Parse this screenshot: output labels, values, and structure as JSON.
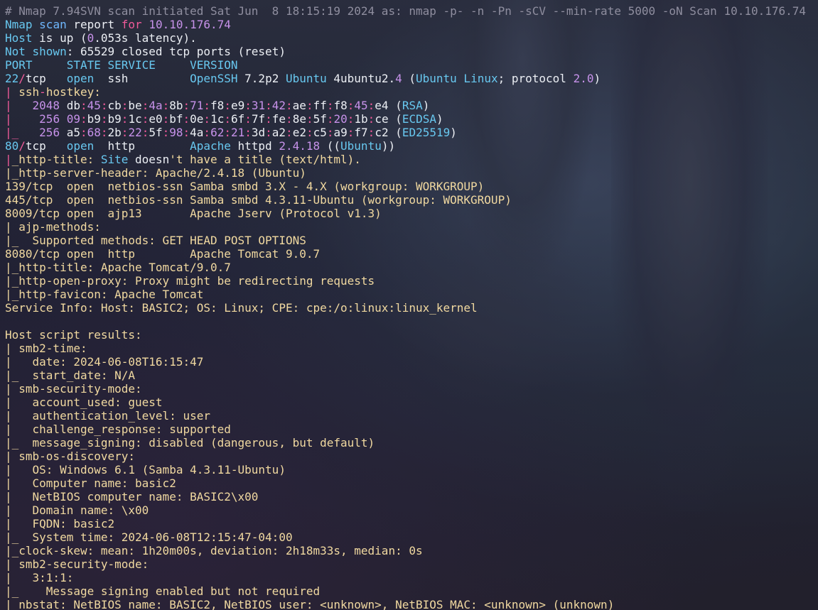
{
  "terminal": {
    "lines": [
      {
        "segments": [
          {
            "t": "# Nmap 7.94SVN scan initiated Sat Jun  8 18:15:19 2024 as: nmap -p- -n -Pn -sCV --min-rate 5000 -oN Scan 10.10.176.74",
            "c": "comment"
          }
        ]
      },
      {
        "segments": [
          {
            "t": "Nmap",
            "c": "cyan"
          },
          {
            "t": " ",
            "c": "white"
          },
          {
            "t": "scan",
            "c": "blue"
          },
          {
            "t": " report ",
            "c": "white"
          },
          {
            "t": "for",
            "c": "pink"
          },
          {
            "t": " ",
            "c": "white"
          },
          {
            "t": "10.10.176.74",
            "c": "purple"
          }
        ]
      },
      {
        "segments": [
          {
            "t": "Host",
            "c": "cyan"
          },
          {
            "t": " is up (",
            "c": "white"
          },
          {
            "t": "0",
            "c": "purple"
          },
          {
            "t": ".053s latency).",
            "c": "white"
          }
        ]
      },
      {
        "segments": [
          {
            "t": "Not shown",
            "c": "cyan"
          },
          {
            "t": ": 65529 closed tcp ports (reset)",
            "c": "white"
          }
        ]
      },
      {
        "segments": [
          {
            "t": "PORT     STATE SERVICE     VERSION",
            "c": "cyan"
          }
        ]
      },
      {
        "segments": [
          {
            "t": "22",
            "c": "cyan"
          },
          {
            "t": "/",
            "c": "pink"
          },
          {
            "t": "tcp   ",
            "c": "white"
          },
          {
            "t": "open",
            "c": "cyan"
          },
          {
            "t": "  ssh         ",
            "c": "white"
          },
          {
            "t": "OpenSSH",
            "c": "cyan"
          },
          {
            "t": " 7.2p2 ",
            "c": "white"
          },
          {
            "t": "Ubuntu",
            "c": "cyan"
          },
          {
            "t": " 4ubuntu2.",
            "c": "white"
          },
          {
            "t": "4",
            "c": "purple"
          },
          {
            "t": " (",
            "c": "white"
          },
          {
            "t": "Ubuntu Linux",
            "c": "cyan"
          },
          {
            "t": "; protocol ",
            "c": "white"
          },
          {
            "t": "2.0",
            "c": "purple"
          },
          {
            "t": ")",
            "c": "white"
          }
        ]
      },
      {
        "segments": [
          {
            "t": "| ",
            "c": "pink"
          },
          {
            "t": "ssh",
            "c": "gold"
          },
          {
            "t": "-",
            "c": "pink"
          },
          {
            "t": "hostkey:",
            "c": "gold"
          }
        ]
      },
      {
        "segments": [
          {
            "t": "|   ",
            "c": "pink"
          },
          {
            "t": "2048",
            "c": "purple"
          },
          {
            "t": " db",
            "c": "white"
          },
          {
            "t": ":",
            "c": "pink"
          },
          {
            "t": "45",
            "c": "purple"
          },
          {
            "t": ":",
            "c": "pink"
          },
          {
            "t": "cb",
            "c": "white"
          },
          {
            "t": ":",
            "c": "pink"
          },
          {
            "t": "be",
            "c": "white"
          },
          {
            "t": ":",
            "c": "pink"
          },
          {
            "t": "4a",
            "c": "purple"
          },
          {
            "t": ":",
            "c": "pink"
          },
          {
            "t": "8b",
            "c": "white"
          },
          {
            "t": ":",
            "c": "pink"
          },
          {
            "t": "71",
            "c": "purple"
          },
          {
            "t": ":",
            "c": "pink"
          },
          {
            "t": "f8",
            "c": "white"
          },
          {
            "t": ":",
            "c": "pink"
          },
          {
            "t": "e9",
            "c": "white"
          },
          {
            "t": ":",
            "c": "pink"
          },
          {
            "t": "31",
            "c": "purple"
          },
          {
            "t": ":",
            "c": "pink"
          },
          {
            "t": "42",
            "c": "purple"
          },
          {
            "t": ":",
            "c": "pink"
          },
          {
            "t": "ae",
            "c": "white"
          },
          {
            "t": ":",
            "c": "pink"
          },
          {
            "t": "ff",
            "c": "white"
          },
          {
            "t": ":",
            "c": "pink"
          },
          {
            "t": "f8",
            "c": "white"
          },
          {
            "t": ":",
            "c": "pink"
          },
          {
            "t": "45",
            "c": "purple"
          },
          {
            "t": ":",
            "c": "pink"
          },
          {
            "t": "e4",
            "c": "white"
          },
          {
            "t": " (",
            "c": "white"
          },
          {
            "t": "RSA",
            "c": "cyan"
          },
          {
            "t": ")",
            "c": "white"
          }
        ]
      },
      {
        "segments": [
          {
            "t": "|    ",
            "c": "pink"
          },
          {
            "t": "256",
            "c": "purple"
          },
          {
            "t": " ",
            "c": "white"
          },
          {
            "t": "09",
            "c": "purple"
          },
          {
            "t": ":",
            "c": "pink"
          },
          {
            "t": "b9",
            "c": "white"
          },
          {
            "t": ":",
            "c": "pink"
          },
          {
            "t": "b9",
            "c": "white"
          },
          {
            "t": ":",
            "c": "pink"
          },
          {
            "t": "1c",
            "c": "white"
          },
          {
            "t": ":",
            "c": "pink"
          },
          {
            "t": "e0",
            "c": "white"
          },
          {
            "t": ":",
            "c": "pink"
          },
          {
            "t": "bf",
            "c": "white"
          },
          {
            "t": ":",
            "c": "pink"
          },
          {
            "t": "0e",
            "c": "white"
          },
          {
            "t": ":",
            "c": "pink"
          },
          {
            "t": "1c",
            "c": "white"
          },
          {
            "t": ":",
            "c": "pink"
          },
          {
            "t": "6f",
            "c": "white"
          },
          {
            "t": ":",
            "c": "pink"
          },
          {
            "t": "7f",
            "c": "white"
          },
          {
            "t": ":",
            "c": "pink"
          },
          {
            "t": "fe",
            "c": "white"
          },
          {
            "t": ":",
            "c": "pink"
          },
          {
            "t": "8e",
            "c": "white"
          },
          {
            "t": ":",
            "c": "pink"
          },
          {
            "t": "5f",
            "c": "white"
          },
          {
            "t": ":",
            "c": "pink"
          },
          {
            "t": "20",
            "c": "purple"
          },
          {
            "t": ":",
            "c": "pink"
          },
          {
            "t": "1b",
            "c": "white"
          },
          {
            "t": ":",
            "c": "pink"
          },
          {
            "t": "ce",
            "c": "white"
          },
          {
            "t": " (",
            "c": "white"
          },
          {
            "t": "ECDSA",
            "c": "cyan"
          },
          {
            "t": ")",
            "c": "white"
          }
        ]
      },
      {
        "segments": [
          {
            "t": "|_   ",
            "c": "pink"
          },
          {
            "t": "256",
            "c": "purple"
          },
          {
            "t": " a5",
            "c": "white"
          },
          {
            "t": ":",
            "c": "pink"
          },
          {
            "t": "68",
            "c": "purple"
          },
          {
            "t": ":",
            "c": "pink"
          },
          {
            "t": "2b",
            "c": "white"
          },
          {
            "t": ":",
            "c": "pink"
          },
          {
            "t": "22",
            "c": "purple"
          },
          {
            "t": ":",
            "c": "pink"
          },
          {
            "t": "5f",
            "c": "white"
          },
          {
            "t": ":",
            "c": "pink"
          },
          {
            "t": "98",
            "c": "purple"
          },
          {
            "t": ":",
            "c": "pink"
          },
          {
            "t": "4a",
            "c": "white"
          },
          {
            "t": ":",
            "c": "pink"
          },
          {
            "t": "62",
            "c": "purple"
          },
          {
            "t": ":",
            "c": "pink"
          },
          {
            "t": "21",
            "c": "purple"
          },
          {
            "t": ":",
            "c": "pink"
          },
          {
            "t": "3d",
            "c": "white"
          },
          {
            "t": ":",
            "c": "pink"
          },
          {
            "t": "a2",
            "c": "white"
          },
          {
            "t": ":",
            "c": "pink"
          },
          {
            "t": "e2",
            "c": "white"
          },
          {
            "t": ":",
            "c": "pink"
          },
          {
            "t": "c5",
            "c": "white"
          },
          {
            "t": ":",
            "c": "pink"
          },
          {
            "t": "a9",
            "c": "white"
          },
          {
            "t": ":",
            "c": "pink"
          },
          {
            "t": "f7",
            "c": "white"
          },
          {
            "t": ":",
            "c": "pink"
          },
          {
            "t": "c2",
            "c": "white"
          },
          {
            "t": " (",
            "c": "white"
          },
          {
            "t": "ED25519",
            "c": "cyan"
          },
          {
            "t": ")",
            "c": "white"
          }
        ]
      },
      {
        "segments": [
          {
            "t": "80",
            "c": "cyan"
          },
          {
            "t": "/",
            "c": "pink"
          },
          {
            "t": "tcp   ",
            "c": "white"
          },
          {
            "t": "open",
            "c": "cyan"
          },
          {
            "t": "  http        ",
            "c": "white"
          },
          {
            "t": "Apache",
            "c": "cyan"
          },
          {
            "t": " httpd ",
            "c": "white"
          },
          {
            "t": "2.4.18",
            "c": "purple"
          },
          {
            "t": " ((",
            "c": "white"
          },
          {
            "t": "Ubuntu",
            "c": "cyan"
          },
          {
            "t": "))",
            "c": "white"
          }
        ]
      },
      {
        "segments": [
          {
            "t": "|",
            "c": "pink"
          },
          {
            "t": "_http-title: ",
            "c": "gold"
          },
          {
            "t": "Site",
            "c": "cyan"
          },
          {
            "t": " doesn",
            "c": "white"
          },
          {
            "t": "'t have a title (text/html).",
            "c": "gold"
          }
        ]
      },
      {
        "segments": [
          {
            "t": "|_http-server-header: Apache/2.4.18 (Ubuntu)",
            "c": "gold"
          }
        ]
      },
      {
        "segments": [
          {
            "t": "139/tcp  open  netbios-ssn Samba smbd 3.X - 4.X (workgroup: WORKGROUP)",
            "c": "gold"
          }
        ]
      },
      {
        "segments": [
          {
            "t": "445/tcp  open  netbios-ssn Samba smbd 4.3.11-Ubuntu (workgroup: WORKGROUP)",
            "c": "gold"
          }
        ]
      },
      {
        "segments": [
          {
            "t": "8009/tcp open  ajp13       Apache Jserv (Protocol v1.3)",
            "c": "gold"
          }
        ]
      },
      {
        "segments": [
          {
            "t": "| ajp-methods:",
            "c": "gold"
          }
        ]
      },
      {
        "segments": [
          {
            "t": "|_  Supported methods: GET HEAD POST OPTIONS",
            "c": "gold"
          }
        ]
      },
      {
        "segments": [
          {
            "t": "8080/tcp open  http        Apache Tomcat 9.0.7",
            "c": "gold"
          }
        ]
      },
      {
        "segments": [
          {
            "t": "|_http-title: Apache Tomcat/9.0.7",
            "c": "gold"
          }
        ]
      },
      {
        "segments": [
          {
            "t": "|_http-open-proxy: Proxy might be redirecting requests",
            "c": "gold"
          }
        ]
      },
      {
        "segments": [
          {
            "t": "|_http-favicon: Apache Tomcat",
            "c": "gold"
          }
        ]
      },
      {
        "segments": [
          {
            "t": "Service Info: Host: BASIC2; OS: Linux; CPE: cpe:/o:linux:linux_kernel",
            "c": "gold"
          }
        ]
      },
      {
        "segments": [
          {
            "t": "",
            "c": "gold"
          }
        ]
      },
      {
        "segments": [
          {
            "t": "Host script results:",
            "c": "gold"
          }
        ]
      },
      {
        "segments": [
          {
            "t": "| smb2-time:",
            "c": "gold"
          }
        ]
      },
      {
        "segments": [
          {
            "t": "|   date: 2024-06-08T16:15:47",
            "c": "gold"
          }
        ]
      },
      {
        "segments": [
          {
            "t": "|_  start_date: N/A",
            "c": "gold"
          }
        ]
      },
      {
        "segments": [
          {
            "t": "| smb-security-mode:",
            "c": "gold"
          }
        ]
      },
      {
        "segments": [
          {
            "t": "|   account_used: guest",
            "c": "gold"
          }
        ]
      },
      {
        "segments": [
          {
            "t": "|   authentication_level: user",
            "c": "gold"
          }
        ]
      },
      {
        "segments": [
          {
            "t": "|   challenge_response: supported",
            "c": "gold"
          }
        ]
      },
      {
        "segments": [
          {
            "t": "|_  message_signing: disabled (dangerous, but default)",
            "c": "gold"
          }
        ]
      },
      {
        "segments": [
          {
            "t": "| smb-os-discovery:",
            "c": "gold"
          }
        ]
      },
      {
        "segments": [
          {
            "t": "|   OS: Windows 6.1 (Samba 4.3.11-Ubuntu)",
            "c": "gold"
          }
        ]
      },
      {
        "segments": [
          {
            "t": "|   Computer name: basic2",
            "c": "gold"
          }
        ]
      },
      {
        "segments": [
          {
            "t": "|   NetBIOS computer name: BASIC2\\x00",
            "c": "gold"
          }
        ]
      },
      {
        "segments": [
          {
            "t": "|   Domain name: \\x00",
            "c": "gold"
          }
        ]
      },
      {
        "segments": [
          {
            "t": "|   FQDN: basic2",
            "c": "gold"
          }
        ]
      },
      {
        "segments": [
          {
            "t": "|_  System time: 2024-06-08T12:15:47-04:00",
            "c": "gold"
          }
        ]
      },
      {
        "segments": [
          {
            "t": "|_clock-skew: mean: 1h20m00s, deviation: 2h18m33s, median: 0s",
            "c": "gold"
          }
        ]
      },
      {
        "segments": [
          {
            "t": "| smb2-security-mode:",
            "c": "gold"
          }
        ]
      },
      {
        "segments": [
          {
            "t": "|   3:1:1:",
            "c": "gold"
          }
        ]
      },
      {
        "segments": [
          {
            "t": "|_    Message signing enabled but not required",
            "c": "gold"
          }
        ]
      },
      {
        "segments": [
          {
            "t": "|_nbstat: NetBIOS name: BASIC2, NetBIOS user: <unknown>, NetBIOS MAC: <unknown> (unknown)",
            "c": "gold"
          }
        ]
      }
    ]
  }
}
